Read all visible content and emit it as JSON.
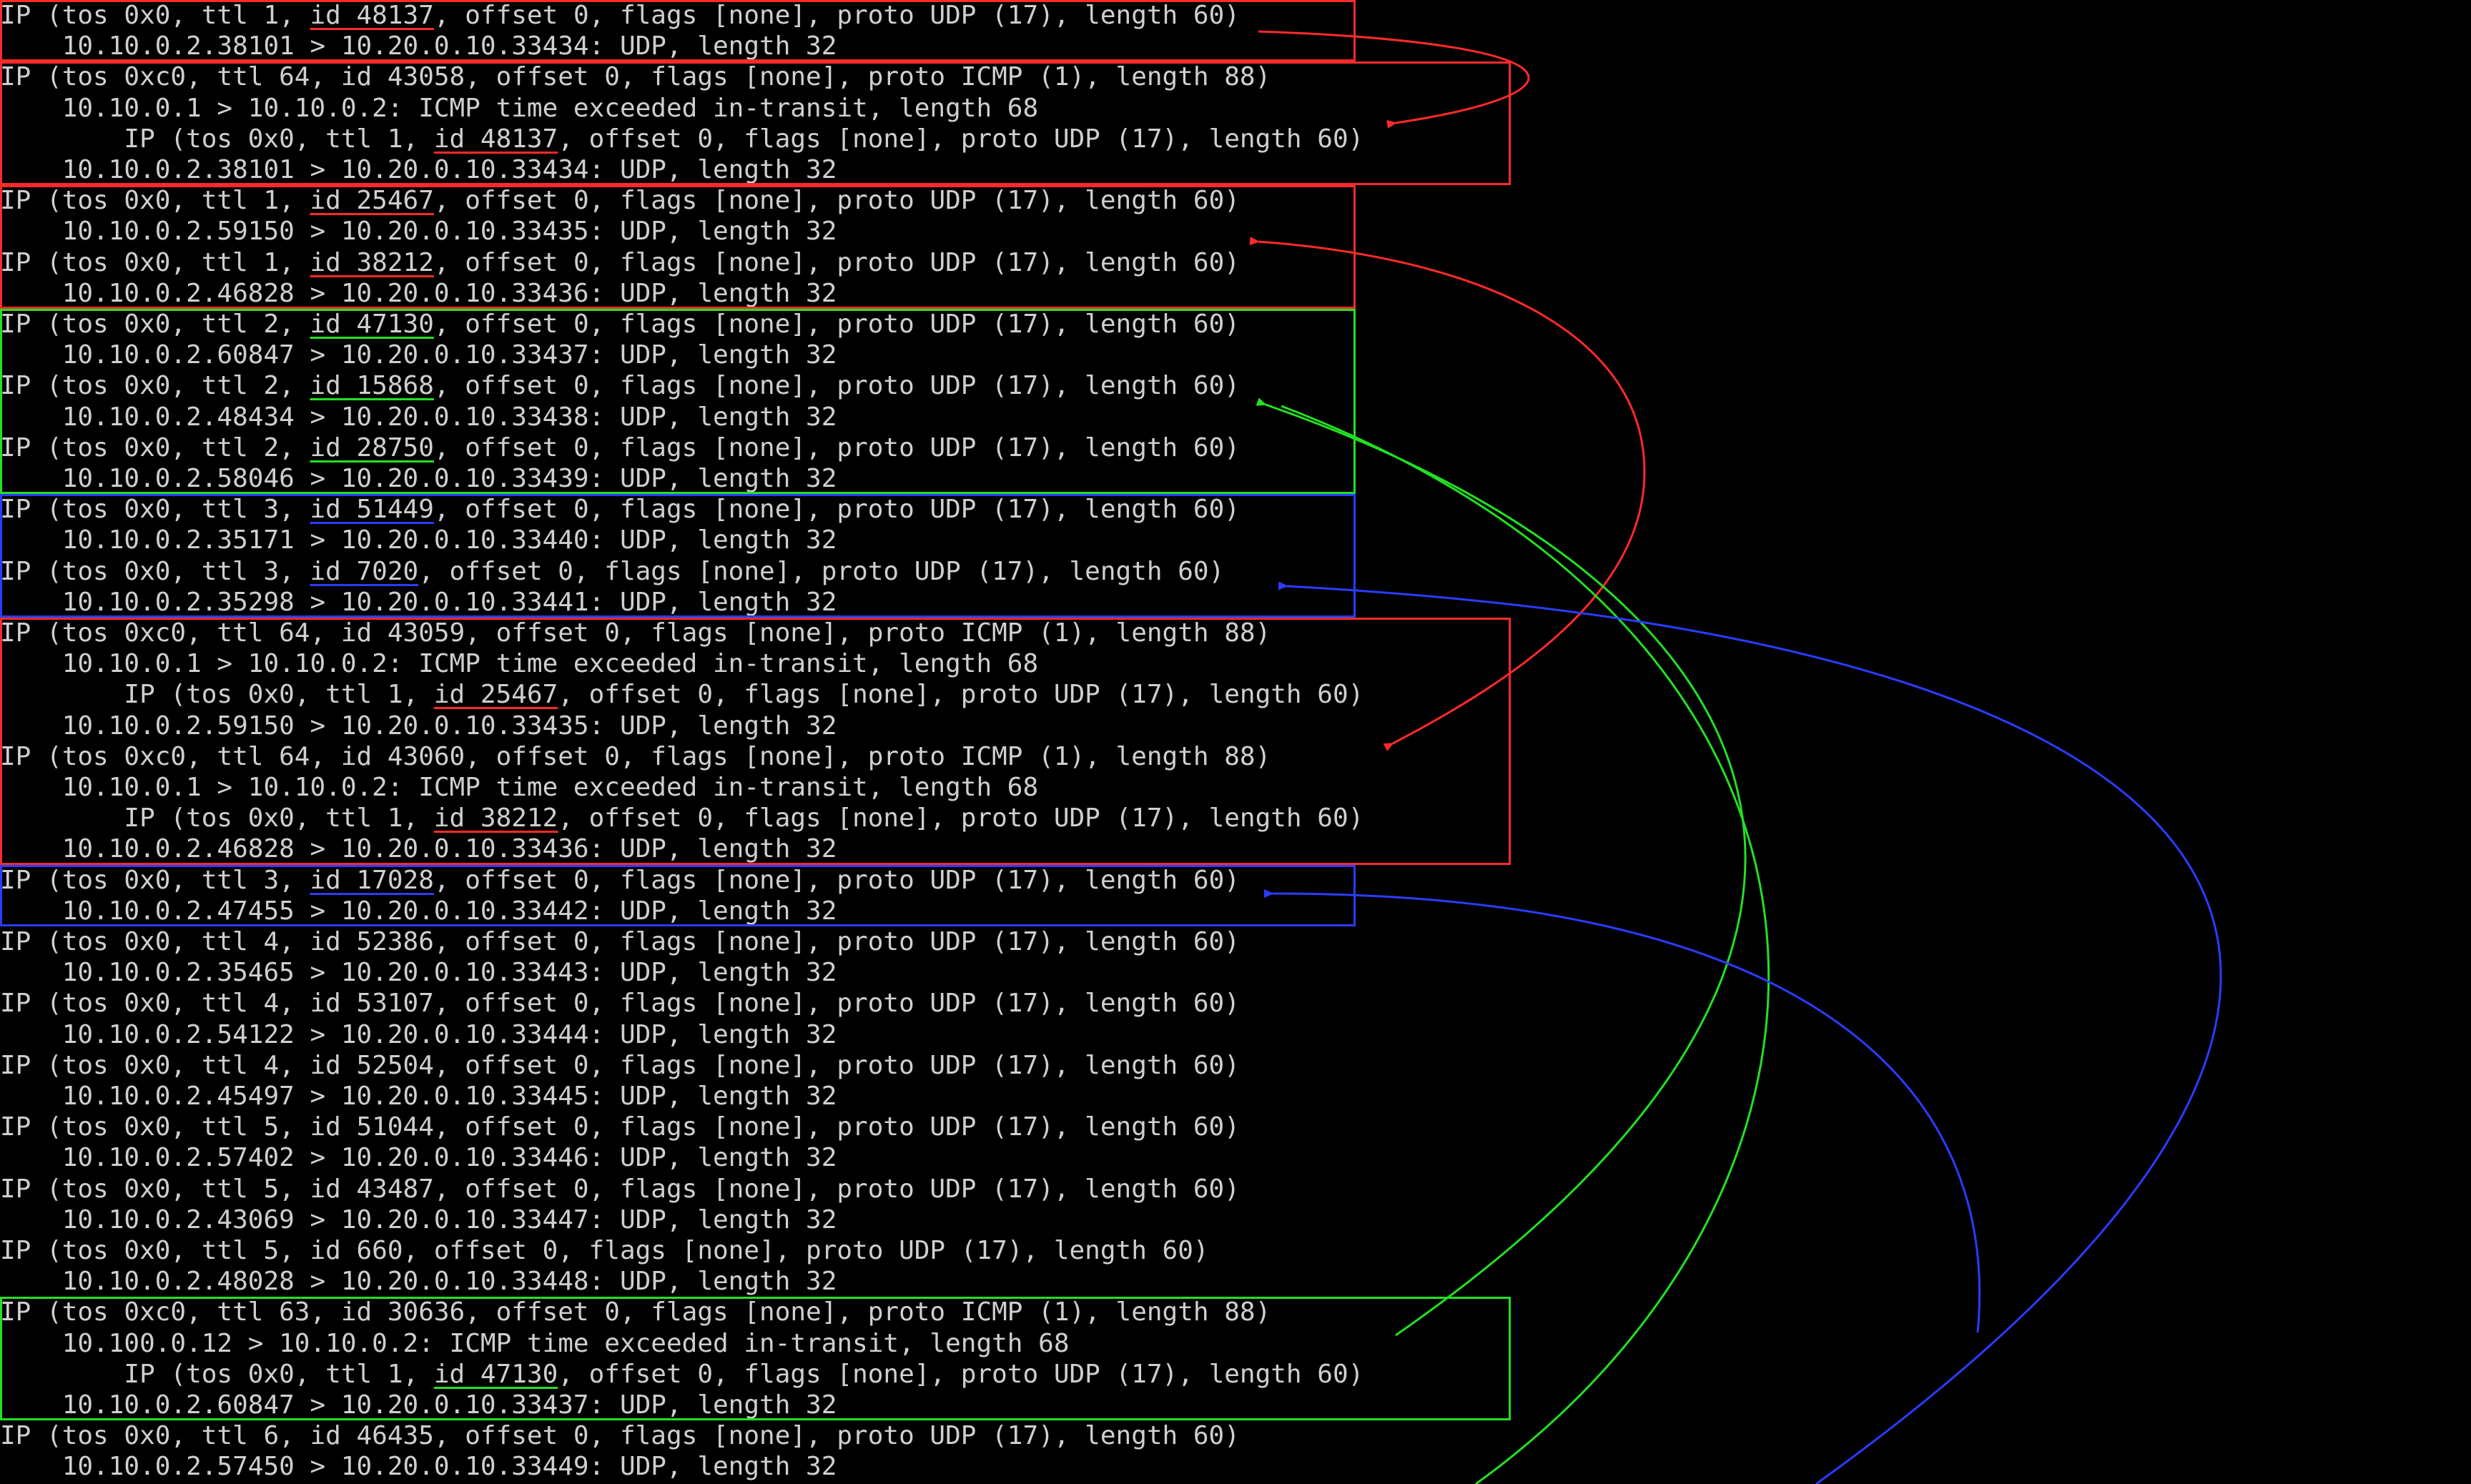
{
  "colors": {
    "background": "#000000",
    "text": "#cfcfcf",
    "dim_text": "#9a9a9a",
    "red": "#ff2a2a",
    "green": "#22e022",
    "blue": "#2a3cff"
  },
  "lines": [
    {
      "text": "IP (tos 0x0, ttl 1, id 48137, offset 0, flags [none], proto UDP (17), length 60)",
      "id": "48137",
      "mark": "red"
    },
    {
      "text": "    10.10.0.2.38101 > 10.20.0.10.33434: UDP, length 32"
    },
    {
      "text": "IP (tos 0xc0, ttl 64, id 43058, offset 0, flags [none], proto ICMP (1), length 88)"
    },
    {
      "text": "    10.10.0.1 > 10.10.0.2: ICMP time exceeded in-transit, length 68"
    },
    {
      "text": "        IP (tos 0x0, ttl 1, id 48137, offset 0, flags [none], proto UDP (17), length 60)",
      "id": "48137",
      "mark": "red"
    },
    {
      "text": "    10.10.0.2.38101 > 10.20.0.10.33434: UDP, length 32"
    },
    {
      "text": "IP (tos 0x0, ttl 1, id 25467, offset 0, flags [none], proto UDP (17), length 60)",
      "id": "25467",
      "mark": "red"
    },
    {
      "text": "    10.10.0.2.59150 > 10.20.0.10.33435: UDP, length 32"
    },
    {
      "text": "IP (tos 0x0, ttl 1, id 38212, offset 0, flags [none], proto UDP (17), length 60)",
      "id": "38212",
      "mark": "red"
    },
    {
      "text": "    10.10.0.2.46828 > 10.20.0.10.33436: UDP, length 32"
    },
    {
      "text": "IP (tos 0x0, ttl 2, id 47130, offset 0, flags [none], proto UDP (17), length 60)",
      "id": "47130",
      "mark": "green"
    },
    {
      "text": "    10.10.0.2.60847 > 10.20.0.10.33437: UDP, length 32"
    },
    {
      "text": "IP (tos 0x0, ttl 2, id 15868, offset 0, flags [none], proto UDP (17), length 60)",
      "id": "15868",
      "mark": "green"
    },
    {
      "text": "    10.10.0.2.48434 > 10.20.0.10.33438: UDP, length 32"
    },
    {
      "text": "IP (tos 0x0, ttl 2, id 28750, offset 0, flags [none], proto UDP (17), length 60)",
      "id": "28750",
      "mark": "green"
    },
    {
      "text": "    10.10.0.2.58046 > 10.20.0.10.33439: UDP, length 32"
    },
    {
      "text": "IP (tos 0x0, ttl 3, id 51449, offset 0, flags [none], proto UDP (17), length 60)",
      "id": "51449",
      "mark": "blue"
    },
    {
      "text": "    10.10.0.2.35171 > 10.20.0.10.33440: UDP, length 32"
    },
    {
      "text": "IP (tos 0x0, ttl 3, id 7020, offset 0, flags [none], proto UDP (17), length 60)",
      "id": "7020",
      "mark": "blue"
    },
    {
      "text": "    10.10.0.2.35298 > 10.20.0.10.33441: UDP, length 32"
    },
    {
      "text": "IP (tos 0xc0, ttl 64, id 43059, offset 0, flags [none], proto ICMP (1), length 88)"
    },
    {
      "text": "    10.10.0.1 > 10.10.0.2: ICMP time exceeded in-transit, length 68"
    },
    {
      "text": "        IP (tos 0x0, ttl 1, id 25467, offset 0, flags [none], proto UDP (17), length 60)",
      "id": "25467",
      "mark": "red"
    },
    {
      "text": "    10.10.0.2.59150 > 10.20.0.10.33435: UDP, length 32"
    },
    {
      "text": "IP (tos 0xc0, ttl 64, id 43060, offset 0, flags [none], proto ICMP (1), length 88)"
    },
    {
      "text": "    10.10.0.1 > 10.10.0.2: ICMP time exceeded in-transit, length 68"
    },
    {
      "text": "        IP (tos 0x0, ttl 1, id 38212, offset 0, flags [none], proto UDP (17), length 60)",
      "id": "38212",
      "mark": "red"
    },
    {
      "text": "    10.10.0.2.46828 > 10.20.0.10.33436: UDP, length 32"
    },
    {
      "text": "IP (tos 0x0, ttl 3, id 17028, offset 0, flags [none], proto UDP (17), length 60)",
      "id": "17028",
      "mark": "blue"
    },
    {
      "text": "    10.10.0.2.47455 > 10.20.0.10.33442: UDP, length 32"
    },
    {
      "text": "IP (tos 0x0, ttl 4, id 52386, offset 0, flags [none], proto UDP (17), length 60)"
    },
    {
      "text": "    10.10.0.2.35465 > 10.20.0.10.33443: UDP, length 32"
    },
    {
      "text": "IP (tos 0x0, ttl 4, id 53107, offset 0, flags [none], proto UDP (17), length 60)"
    },
    {
      "text": "    10.10.0.2.54122 > 10.20.0.10.33444: UDP, length 32"
    },
    {
      "text": "IP (tos 0x0, ttl 4, id 52504, offset 0, flags [none], proto UDP (17), length 60)"
    },
    {
      "text": "    10.10.0.2.45497 > 10.20.0.10.33445: UDP, length 32"
    },
    {
      "text": "IP (tos 0x0, ttl 5, id 51044, offset 0, flags [none], proto UDP (17), length 60)"
    },
    {
      "text": "    10.10.0.2.57402 > 10.20.0.10.33446: UDP, length 32"
    },
    {
      "text": "IP (tos 0x0, ttl 5, id 43487, offset 0, flags [none], proto UDP (17), length 60)"
    },
    {
      "text": "    10.10.0.2.43069 > 10.20.0.10.33447: UDP, length 32"
    },
    {
      "text": "IP (tos 0x0, ttl 5, id 660, offset 0, flags [none], proto UDP (17), length 60)"
    },
    {
      "text": "    10.10.0.2.48028 > 10.20.0.10.33448: UDP, length 32"
    },
    {
      "text": "IP (tos 0xc0, ttl 63, id 30636, offset 0, flags [none], proto ICMP (1), length 88)"
    },
    {
      "text": "    10.100.0.12 > 10.10.0.2: ICMP time exceeded in-transit, length 68"
    },
    {
      "text": "        IP (tos 0x0, ttl 1, id 47130, offset 0, flags [none], proto UDP (17), length 60)",
      "id": "47130",
      "mark": "green"
    },
    {
      "text": "    10.10.0.2.60847 > 10.20.0.10.33437: UDP, length 32"
    },
    {
      "text": "IP (tos 0x0, ttl 6, id 46435, offset 0, flags [none], proto UDP (17), length 60)"
    },
    {
      "text": "    10.10.0.2.57450 > 10.20.0.10.33449: UDP, length 32"
    }
  ],
  "boxes": [
    {
      "color": "red",
      "first_line": 0,
      "last_line": 1,
      "width_chars": 87
    },
    {
      "color": "red",
      "first_line": 2,
      "last_line": 5,
      "width_chars": 97
    },
    {
      "color": "red",
      "first_line": 6,
      "last_line": 9,
      "width_chars": 87
    },
    {
      "color": "green",
      "first_line": 10,
      "last_line": 15,
      "width_chars": 87
    },
    {
      "color": "blue",
      "first_line": 16,
      "last_line": 19,
      "width_chars": 87
    },
    {
      "color": "red",
      "first_line": 20,
      "last_line": 27,
      "width_chars": 97
    },
    {
      "color": "blue",
      "first_line": 28,
      "last_line": 29,
      "width_chars": 87
    },
    {
      "color": "green",
      "first_line": 42,
      "last_line": 45,
      "width_chars": 97
    }
  ]
}
